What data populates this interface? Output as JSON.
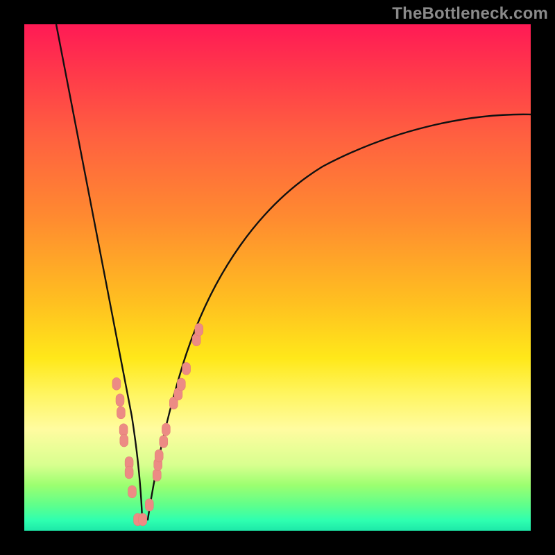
{
  "watermark": {
    "text": "TheBottleneck.com"
  },
  "colors": {
    "background": "#000000",
    "curve_stroke": "#111111",
    "marker_fill": "#ec8b84",
    "marker_stroke": "#e07a72"
  },
  "chart_data": {
    "type": "line",
    "title": "",
    "xlabel": "",
    "ylabel": "",
    "xlim": [
      0,
      1
    ],
    "ylim": [
      0,
      1
    ],
    "note": "Axes are unlabeled in the source image; x/y are normalized to [0,1] fractions of the plot area. y is measured from the bottom (0=bottom, 1=top).",
    "series": [
      {
        "name": "bottleneck-curve",
        "x": [
          0.06,
          0.1,
          0.14,
          0.17,
          0.19,
          0.21,
          0.225,
          0.24,
          0.27,
          0.3,
          0.34,
          0.42,
          0.52,
          0.62,
          0.72,
          0.82,
          0.92,
          1.0
        ],
        "y": [
          1.0,
          0.8,
          0.58,
          0.38,
          0.22,
          0.1,
          0.02,
          0.02,
          0.1,
          0.22,
          0.35,
          0.52,
          0.65,
          0.72,
          0.77,
          0.8,
          0.82,
          0.82
        ]
      }
    ],
    "markers": {
      "name": "highlight-points",
      "x": [
        0.182,
        0.189,
        0.191,
        0.196,
        0.197,
        0.207,
        0.207,
        0.213,
        0.224,
        0.234,
        0.247,
        0.262,
        0.264,
        0.266,
        0.275,
        0.28,
        0.295,
        0.304,
        0.31,
        0.32,
        0.34,
        0.345
      ],
      "y": [
        0.29,
        0.258,
        0.233,
        0.199,
        0.178,
        0.134,
        0.115,
        0.077,
        0.022,
        0.022,
        0.051,
        0.11,
        0.131,
        0.148,
        0.176,
        0.2,
        0.252,
        0.27,
        0.289,
        0.32,
        0.377,
        0.397
      ]
    }
  }
}
